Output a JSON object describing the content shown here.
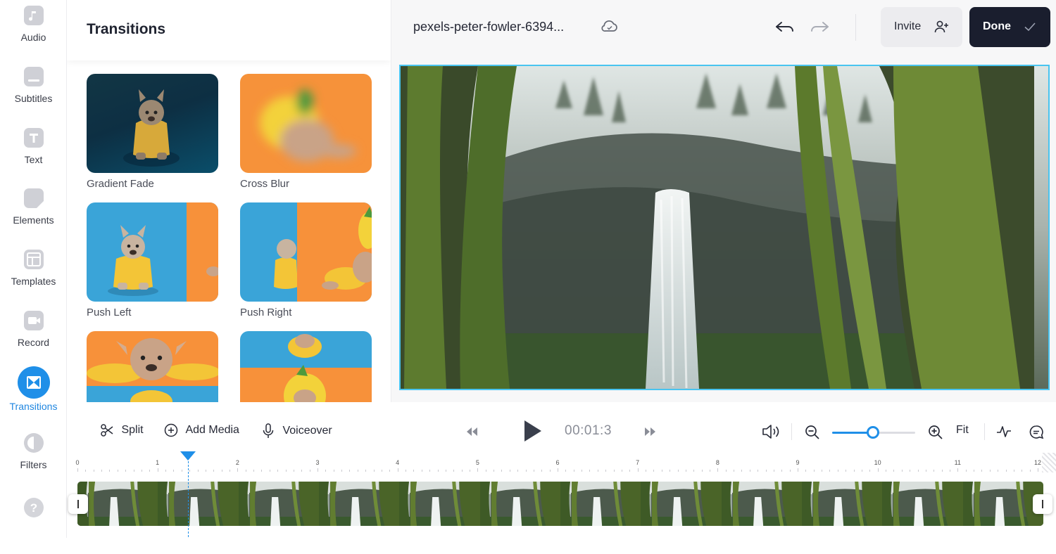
{
  "rail": {
    "items": [
      {
        "label": "Audio",
        "icon": "music-note-icon"
      },
      {
        "label": "Subtitles",
        "icon": "subtitles-icon"
      },
      {
        "label": "Text",
        "icon": "text-icon"
      },
      {
        "label": "Elements",
        "icon": "elements-icon"
      },
      {
        "label": "Templates",
        "icon": "templates-icon"
      },
      {
        "label": "Record",
        "icon": "record-icon"
      },
      {
        "label": "Transitions",
        "icon": "transitions-icon",
        "active": true
      },
      {
        "label": "Filters",
        "icon": "filters-icon"
      }
    ],
    "help_icon": "help-icon",
    "accent": "#1f8fe8"
  },
  "panel": {
    "title": "Transitions",
    "items": [
      {
        "label": "Gradient Fade"
      },
      {
        "label": "Cross Blur"
      },
      {
        "label": "Push Left"
      },
      {
        "label": "Push Right"
      },
      {
        "label": ""
      },
      {
        "label": ""
      }
    ]
  },
  "topbar": {
    "filename": "pexels-peter-fowler-6394...",
    "cloud_icon": "cloud-sync-icon",
    "undo_icon": "undo-icon",
    "redo_icon": "redo-icon",
    "invite_label": "Invite",
    "done_label": "Done"
  },
  "controls": {
    "split_label": "Split",
    "add_media_label": "Add Media",
    "voiceover_label": "Voiceover",
    "time": "00:01:3",
    "fit_label": "Fit",
    "zoom_level": 0.49
  },
  "timeline": {
    "ticks": [
      "0",
      "1",
      "2",
      "3",
      "4",
      "5",
      "6",
      "7",
      "8",
      "9",
      "10",
      "11",
      "12"
    ],
    "playhead_seconds": 1.38,
    "clip_frames": 12
  },
  "colors": {
    "accent": "#1f8fe8",
    "done_bg": "#1a1e2e",
    "preview_border": "#48c4f0"
  }
}
